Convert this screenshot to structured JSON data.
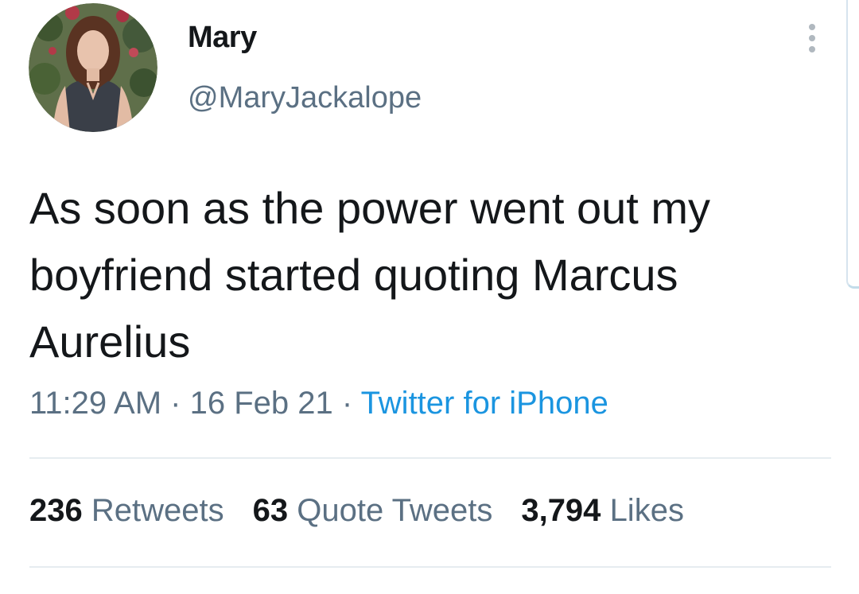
{
  "author": {
    "display_name": "Mary",
    "handle": "@MaryJackalope"
  },
  "tweet": {
    "lines": [
      "As soon as the power went out my",
      "boyfriend started quoting Marcus",
      "Aurelius"
    ],
    "time": "11:29 AM",
    "separator": " · ",
    "date": "16 Feb 21",
    "source": "Twitter for iPhone"
  },
  "stats": {
    "retweets_count": "236",
    "retweets_label": "Retweets",
    "quotes_count": "63",
    "quotes_label": "Quote Tweets",
    "likes_count": "3,794",
    "likes_label": "Likes"
  },
  "colors": {
    "text": "#14171a",
    "secondary": "#5b7083",
    "link": "#1b95e0",
    "divider": "#e6ecf0"
  },
  "icons": {
    "more": "more-vertical-icon"
  }
}
